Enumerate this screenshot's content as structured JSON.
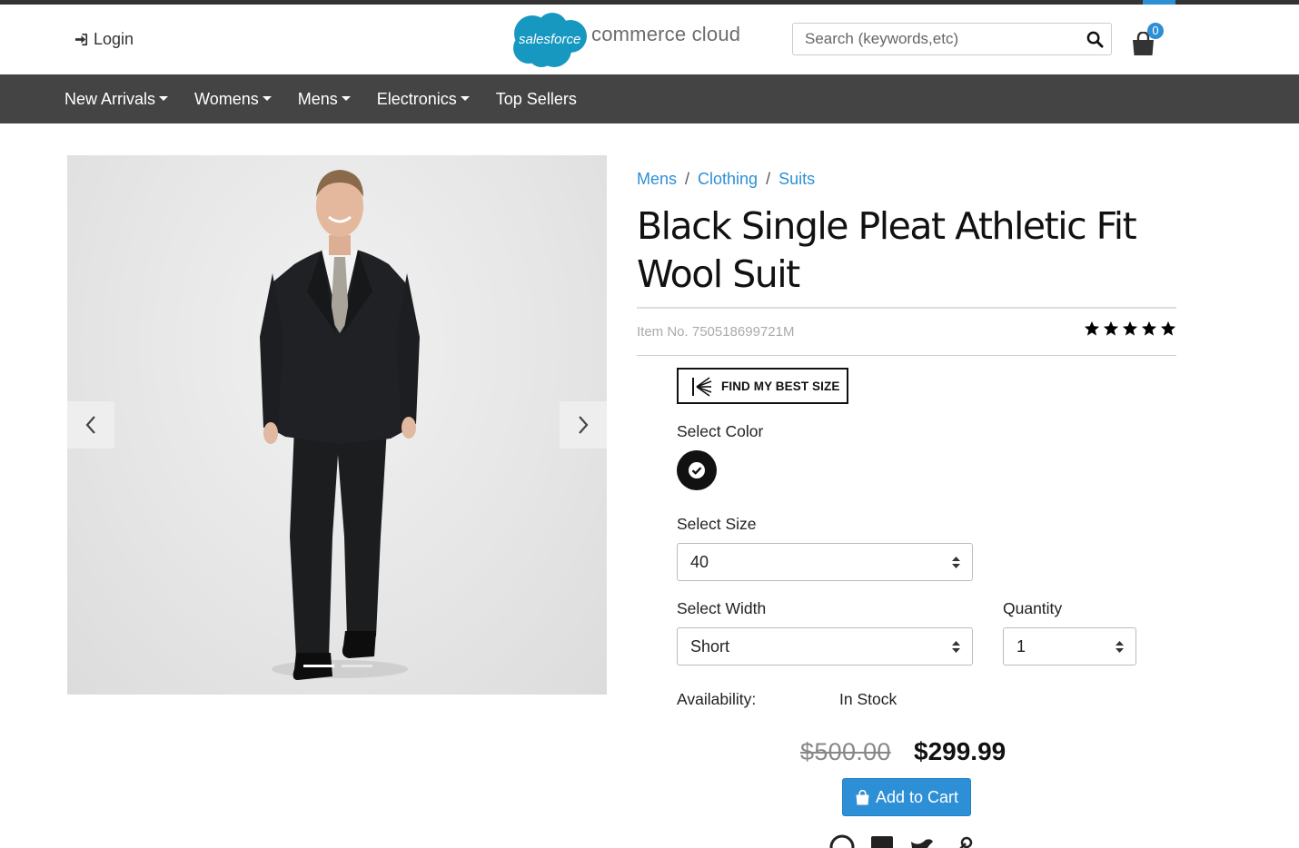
{
  "header": {
    "login_label": "Login",
    "logo": {
      "cloud_text": "salesforce",
      "brand_text": "commerce cloud"
    },
    "search_placeholder": "Search (keywords,etc)",
    "cart_count": "0"
  },
  "nav": {
    "items": [
      {
        "label": "New Arrivals",
        "has_dropdown": true
      },
      {
        "label": "Womens",
        "has_dropdown": true
      },
      {
        "label": "Mens",
        "has_dropdown": true
      },
      {
        "label": "Electronics",
        "has_dropdown": true
      },
      {
        "label": "Top Sellers",
        "has_dropdown": false
      }
    ]
  },
  "gallery": {
    "prev_icon": "chevron-left-icon",
    "next_icon": "chevron-right-icon",
    "slide_count": 2,
    "active_slide": 1
  },
  "product": {
    "breadcrumb": [
      "Mens",
      "Clothing",
      "Suits"
    ],
    "name": "Black Single Pleat Athletic Fit Wool Suit",
    "item_no": "Item No. 750518699721M",
    "rating": 5,
    "best_size_label": "FIND MY BEST SIZE",
    "color_label": "Select Color",
    "selected_color": "#111111",
    "size_label": "Select Size",
    "size_value": "40",
    "width_label": "Select Width",
    "width_value": "Short",
    "quantity_label": "Quantity",
    "quantity_value": "1",
    "availability_label": "Availability:",
    "availability_value": "In Stock",
    "old_price": "$500.00",
    "new_price": "$299.99",
    "add_to_cart_label": "Add to Cart"
  },
  "colors": {
    "accent": "#2d8fd5",
    "nav_bg": "#444444",
    "top_strip": "#333333"
  }
}
